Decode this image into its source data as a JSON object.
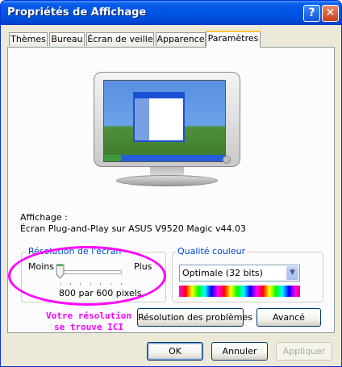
{
  "window": {
    "title": "Propriétés de Affichage",
    "help_label": "?",
    "close_label": "✕"
  },
  "tabs": [
    {
      "label": "Thèmes",
      "active": false
    },
    {
      "label": "Bureau",
      "active": false
    },
    {
      "label": "Écran de veille",
      "active": false
    },
    {
      "label": "Apparence",
      "active": false
    },
    {
      "label": "Paramètres",
      "active": true
    }
  ],
  "display": {
    "label": "Affichage :",
    "device": "Écran Plug-and-Play sur ASUS V9520 Magic v44.03"
  },
  "resolution": {
    "title": "Résolution de l'écran",
    "min_label": "Moins",
    "max_label": "Plus",
    "value_text": "800 par 600 pixels",
    "slider_position_fraction": 0
  },
  "color_quality": {
    "title": "Qualité couleur",
    "selected": "Optimale (32 bits)"
  },
  "annotation": {
    "line1": "Votre résolution",
    "line2": "se trouve ICI",
    "color": "#ff00ff"
  },
  "buttons": {
    "troubleshoot": "Résolution des problèmes",
    "advanced": "Avancé",
    "ok": "OK",
    "cancel": "Annuler",
    "apply": "Appliquer"
  }
}
